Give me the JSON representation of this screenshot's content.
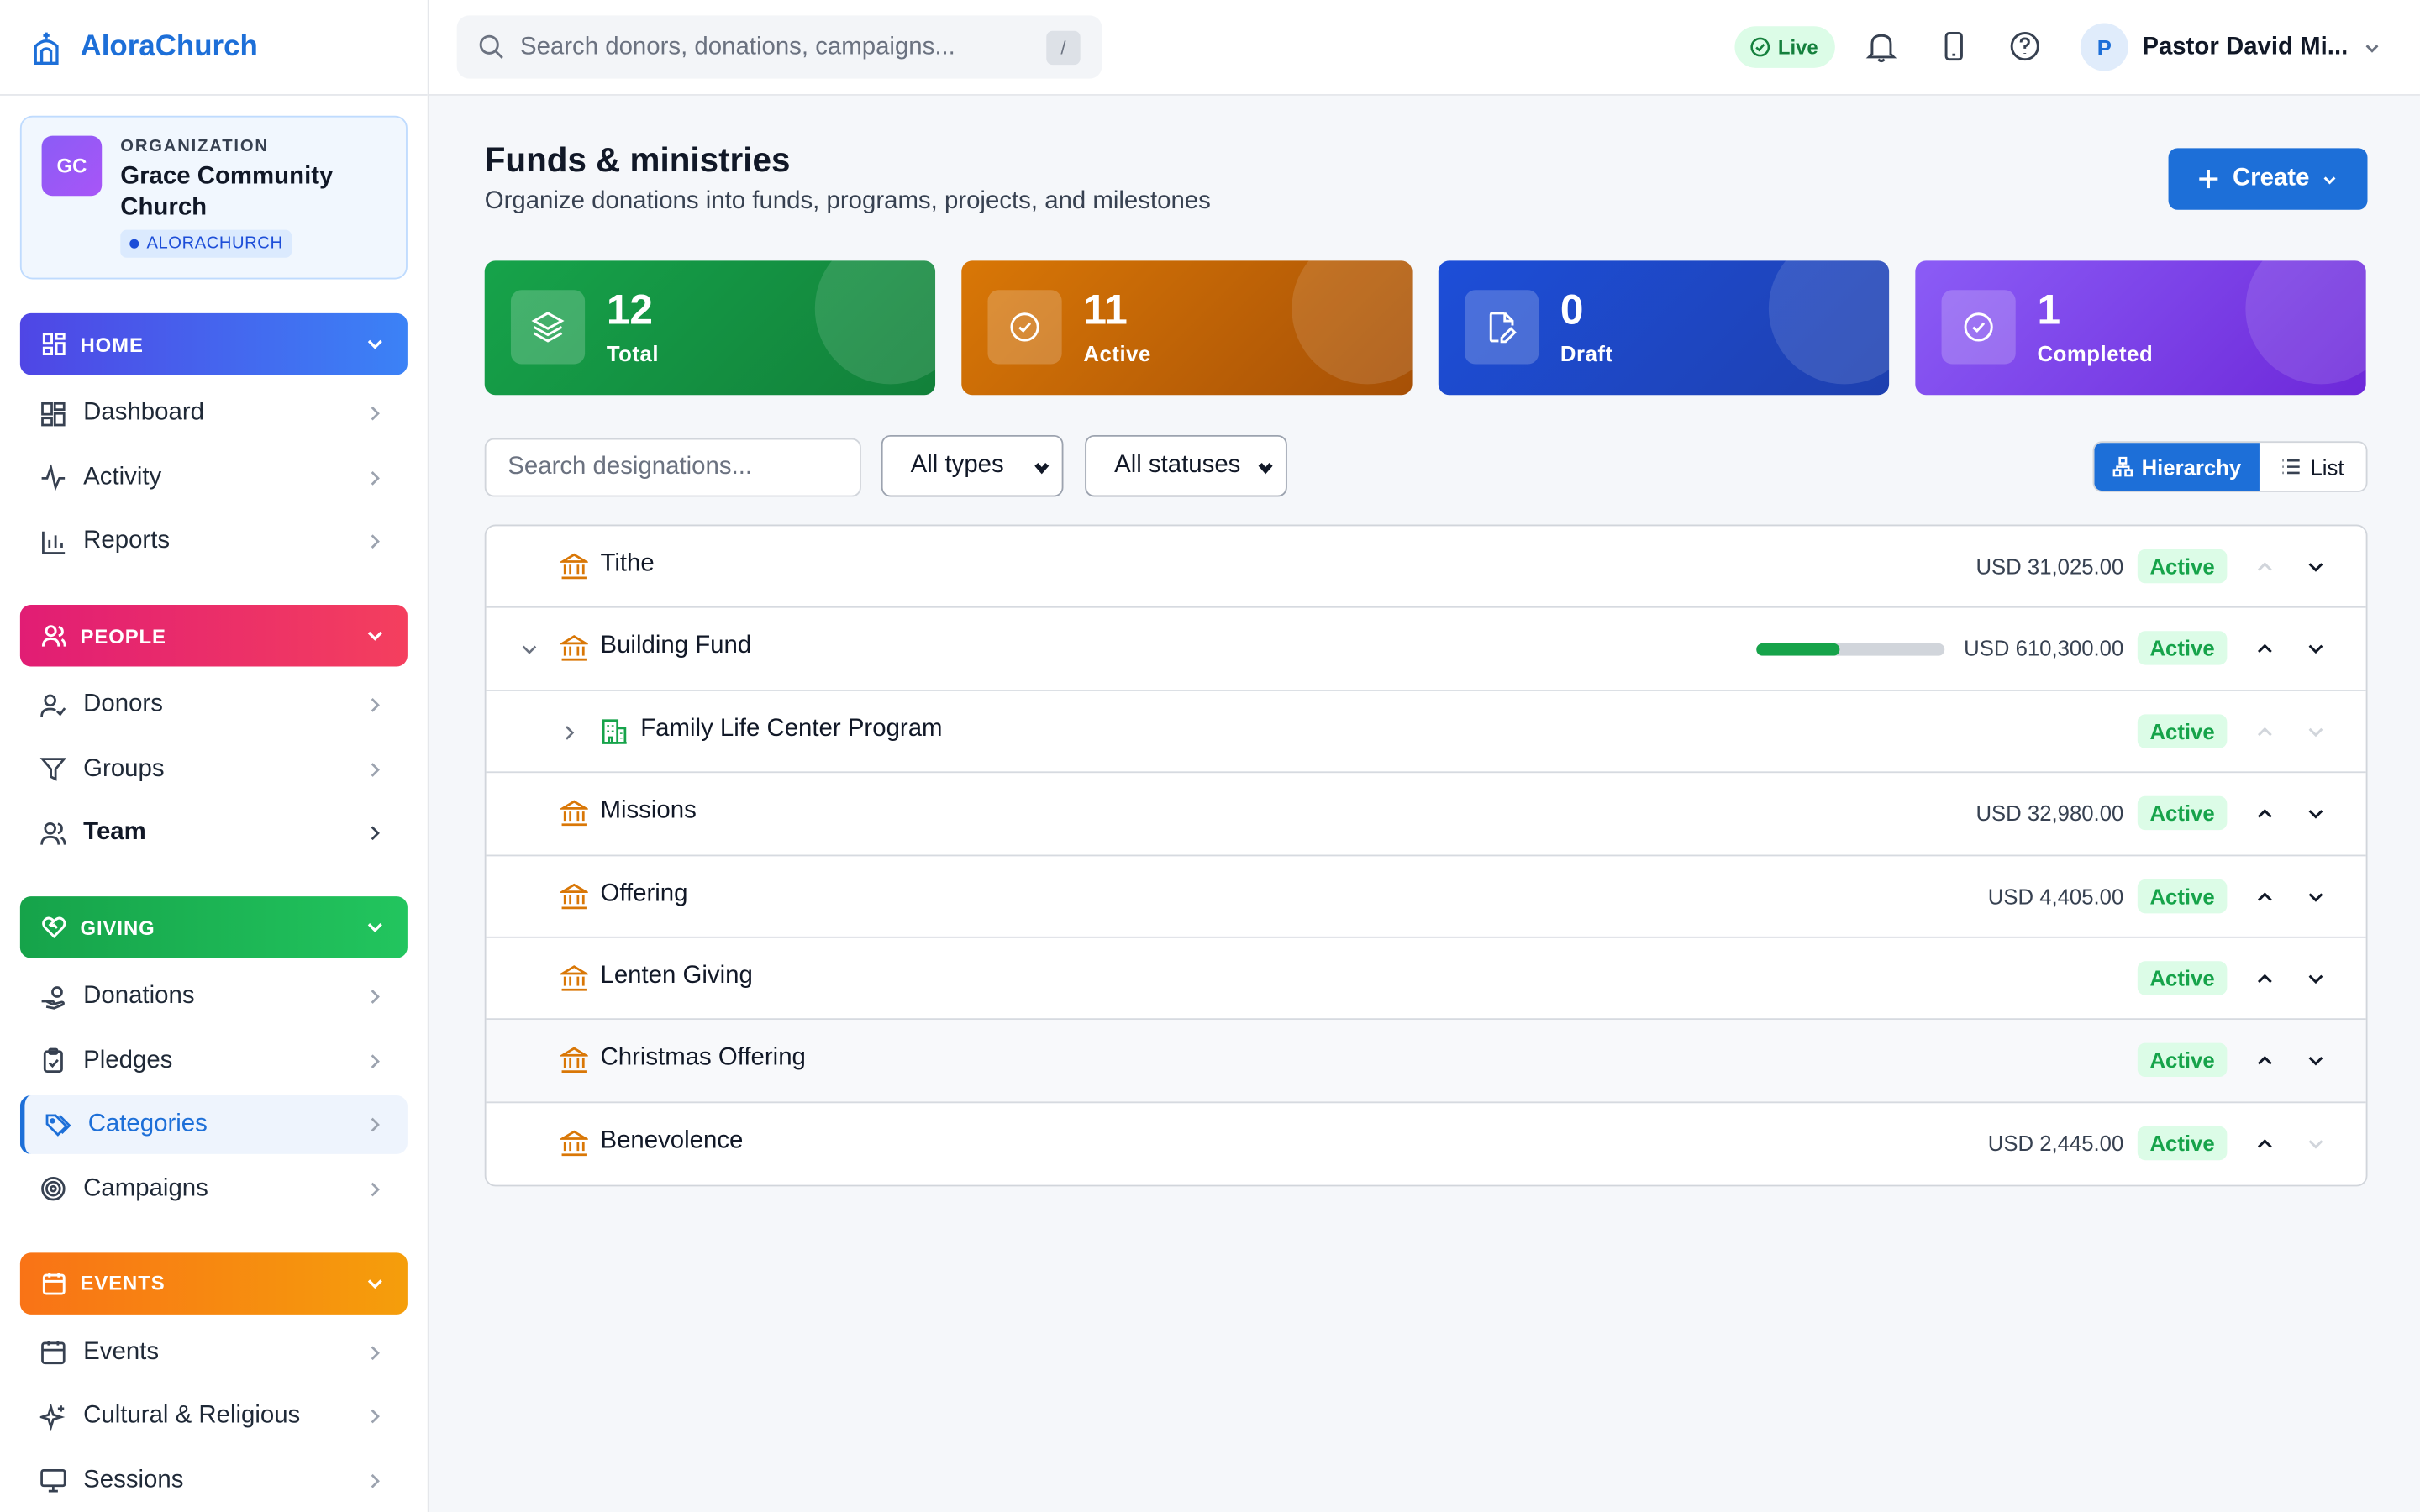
{
  "app": {
    "name": "AloraChurch"
  },
  "org": {
    "label": "ORGANIZATION",
    "name": "Grace Community Church",
    "avatar": "GC",
    "tag": "ALORACHURCH"
  },
  "sidebar": {
    "sections": [
      {
        "title": "HOME",
        "items": [
          "Dashboard",
          "Activity",
          "Reports"
        ]
      },
      {
        "title": "PEOPLE",
        "items": [
          "Donors",
          "Groups",
          "Team"
        ]
      },
      {
        "title": "GIVING",
        "items": [
          "Donations",
          "Pledges",
          "Categories",
          "Campaigns"
        ]
      },
      {
        "title": "EVENTS",
        "items": [
          "Events",
          "Cultural & Religious",
          "Sessions"
        ]
      }
    ],
    "selected": "Categories"
  },
  "topbar": {
    "search_placeholder": "Search donors, donations, campaigns...",
    "search_shortcut": "/",
    "live_label": "Live",
    "user_initial": "P",
    "user_name": "Pastor David Mi..."
  },
  "page": {
    "title": "Funds & ministries",
    "subtitle": "Organize donations into funds, programs, projects, and milestones",
    "create_label": "Create"
  },
  "stats": [
    {
      "value": "12",
      "label": "Total",
      "color": "#16a34a"
    },
    {
      "value": "11",
      "label": "Active",
      "color": "#d97706"
    },
    {
      "value": "0",
      "label": "Draft",
      "color": "#1d4ed8"
    },
    {
      "value": "1",
      "label": "Completed",
      "color": "#7c3aed"
    }
  ],
  "filters": {
    "search_placeholder": "Search designations...",
    "type_select": "All types",
    "status_select": "All statuses",
    "view_hierarchy": "Hierarchy",
    "view_list": "List"
  },
  "rows": [
    {
      "name": "Tithe",
      "amount": "USD 31,025.00",
      "status": "Active"
    },
    {
      "name": "Building Fund",
      "amount": "USD 610,300.00",
      "status": "Active",
      "progress": 0.44
    },
    {
      "name": "Family Life Center Program",
      "amount": "",
      "status": "Active"
    },
    {
      "name": "Missions",
      "amount": "USD 32,980.00",
      "status": "Active"
    },
    {
      "name": "Offering",
      "amount": "USD 4,405.00",
      "status": "Active"
    },
    {
      "name": "Lenten Giving",
      "amount": "",
      "status": "Active"
    },
    {
      "name": "Christmas Offering",
      "amount": "",
      "status": "Active"
    },
    {
      "name": "Benevolence",
      "amount": "USD 2,445.00",
      "status": "Active"
    }
  ]
}
